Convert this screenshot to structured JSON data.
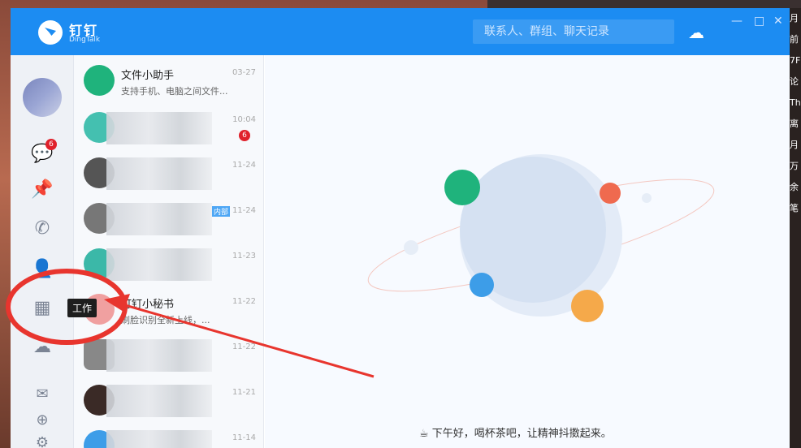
{
  "app": {
    "name": "钉钉",
    "name_en": "DingTalk"
  },
  "search": {
    "placeholder": "联系人、群组、聊天记录"
  },
  "sidebar": {
    "messages_badge": "6",
    "tooltip": "工作"
  },
  "conversations": [
    {
      "title": "文件小助手",
      "preview": "支持手机、电脑之间文件...",
      "time": "03-27"
    },
    {
      "title": "",
      "preview": "",
      "time": "10:04",
      "badge": "6"
    },
    {
      "title": "",
      "preview": "",
      "time": "11-24"
    },
    {
      "title": "",
      "preview": "",
      "time": "11-24",
      "tag": "内部"
    },
    {
      "title": "",
      "preview": "",
      "time": "11-23"
    },
    {
      "title": "钉钉小秘书",
      "preview": "刷脸识别全新上线，...",
      "time": "11-22"
    },
    {
      "title": "",
      "preview": "",
      "time": "11-22"
    },
    {
      "title": "",
      "preview": "",
      "time": "11-21"
    },
    {
      "title": "",
      "preview": "",
      "time": "11-14"
    }
  ],
  "main": {
    "greeting": "下午好，喝杯茶吧，让精神抖擞起来。"
  },
  "desktop": {
    "right_chars": "月 前 7F 论 Th 离 月 万 余 笔"
  },
  "colors": {
    "brand": "#1c8cf2",
    "annotation": "#e8352e"
  }
}
